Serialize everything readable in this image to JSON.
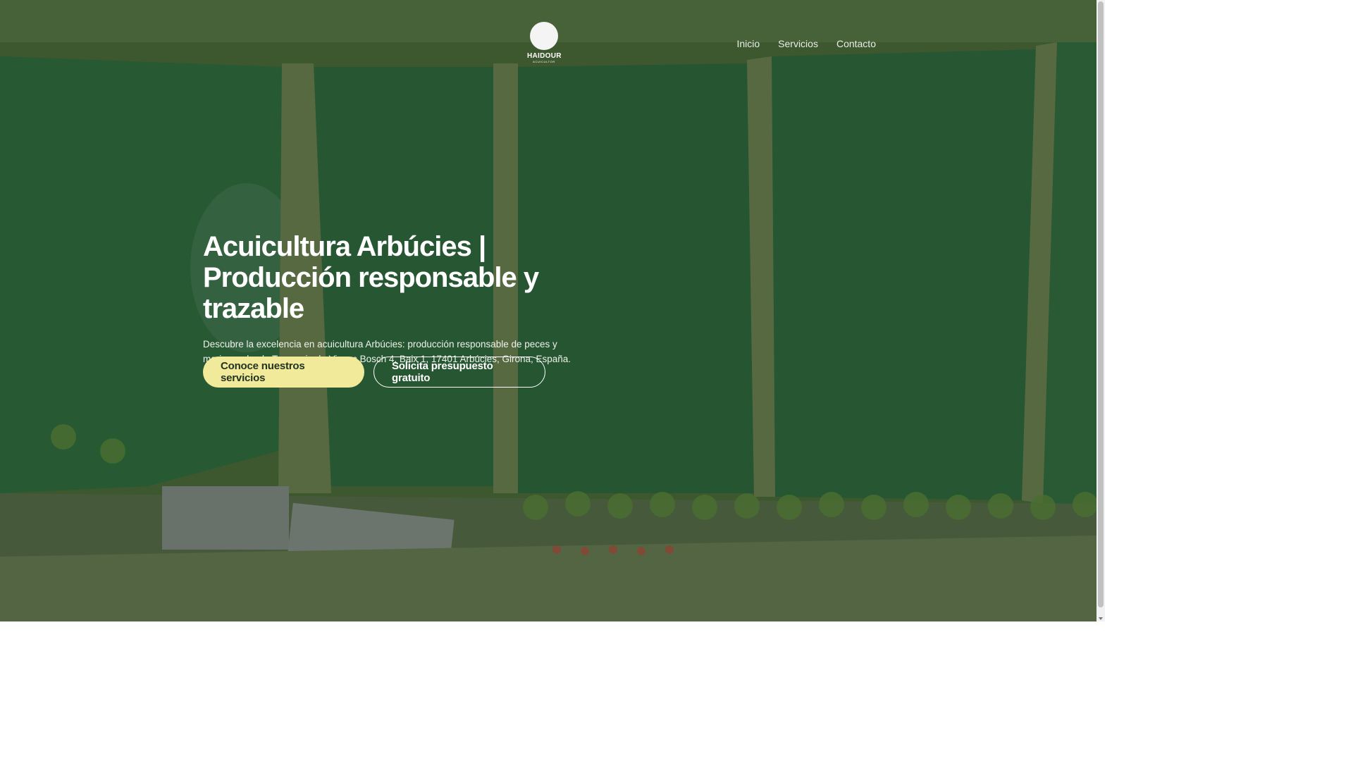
{
  "brand": {
    "name": "HAIDOUR",
    "tagline": "ACUICULTOR"
  },
  "nav": {
    "items": [
      "Inicio",
      "Servicios",
      "Contacto"
    ]
  },
  "hero": {
    "title": "Acuicultura Arbúcies | Producción responsable y trazable",
    "description": "Descubre la excelencia en acuicultura Arbúcies: producción responsable de peces y mariscos desde Travessia de Vicenç Bosch 4, Baix 1, 17401 Arbúcies, Girona, España.",
    "primary_cta": "Conoce nuestros servicios",
    "secondary_cta": "Solicita presupuesto gratuito"
  },
  "colors": {
    "primary_button": "#f2ea9b",
    "pond_water": "#2f6b3c",
    "levee": "#7a8a5c"
  }
}
